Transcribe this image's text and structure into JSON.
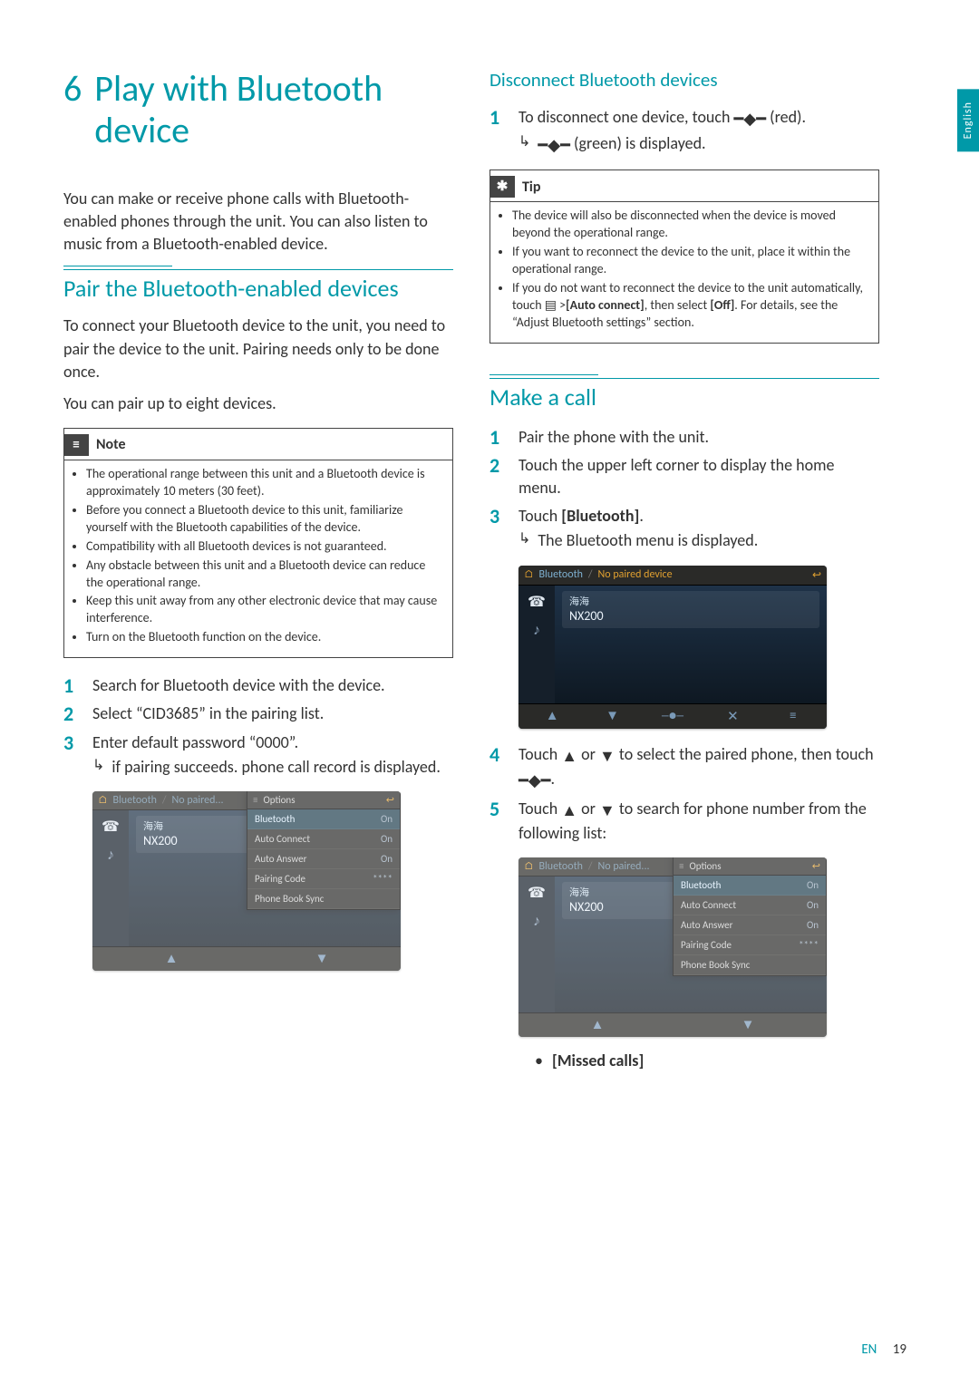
{
  "chapter": {
    "num": "6",
    "title": "Play with Bluetooth device"
  },
  "language_tab": "English",
  "intro": "You can make or receive phone calls with Bluetooth-enabled phones through the unit. You can also listen to music from a Bluetooth-enabled device.",
  "section_pair": {
    "title": "Pair the Bluetooth-enabled devices",
    "p1": "To connect your Bluetooth device to the unit, you need to pair the device to the unit. Pairing needs only to be done once.",
    "p2": "You can pair up to eight devices.",
    "note_label": "Note",
    "notes": [
      "The operational range between this unit and a Bluetooth device is approximately 10 meters (30 feet).",
      "Before you connect a Bluetooth device to this unit, familiarize yourself with the Bluetooth capabilities of the device.",
      "Compatibility with all Bluetooth devices is not guaranteed.",
      "Any obstacle between this unit and a Bluetooth device can reduce the operational range.",
      "Keep this unit away from any other electronic device that may cause interference.",
      "Turn on the Bluetooth function on the device."
    ],
    "steps": {
      "s1": "Search for Bluetooth device with the device.",
      "s2": "Select “CID3685” in the pairing list.",
      "s3": "Enter default password “0000”.",
      "s3_result": "if pairing succeeds. phone call record is displayed."
    }
  },
  "section_disconnect": {
    "title": "Disconnect Bluetooth devices",
    "s1_a": "To disconnect one device, touch ",
    "s1_b": " (red).",
    "s1_result_a": "",
    "s1_result_b": " (green) is displayed.",
    "tip_label": "Tip",
    "tips": [
      "The device will also be disconnected when the device is moved beyond the operational range.",
      "If you want to reconnect the device to the unit, place it within the operational range.",
      "If you do not want to reconnect the device to the unit automatically, touch ≡ >[Auto connect], then select [Off]. For details, see the “Adjust Bluetooth settings” section."
    ],
    "tip3_pre": "If you do not want to reconnect the device to the unit automatically, touch ",
    "tip3_mid": " >",
    "tip3_bold1": "[Auto connect]",
    "tip3_mid2": ", then select ",
    "tip3_bold2": "[Off]",
    "tip3_post": ". For details, see the “Adjust Bluetooth settings” section."
  },
  "section_call": {
    "title": "Make a call",
    "s1": "Pair the phone with the unit.",
    "s2": "Touch the upper left corner to display the home menu.",
    "s3_a": "Touch ",
    "s3_b": "[Bluetooth]",
    "s3_c": ".",
    "s3_result": "The Bluetooth menu is displayed.",
    "s4_a": "Touch ",
    "s4_b": " or ",
    "s4_c": " to select the paired phone, then touch ",
    "s4_d": ".",
    "s5_a": "Touch ",
    "s5_b": " or ",
    "s5_c": " to search for phone number from the following list:",
    "missed": "[Missed calls]"
  },
  "screenshots": {
    "dimmed": true,
    "header_home": "⌂",
    "header_bt": "Bluetooth",
    "header_status": "No paired device",
    "header_return": "↩",
    "device_sub": "海海",
    "device_name": "NX200",
    "side_phone": "☎",
    "side_music": "♪",
    "foot_up": "▲",
    "foot_down": "▼",
    "foot_link": "─●─",
    "foot_x": "✕",
    "foot_menu": "≡",
    "options": {
      "title": "Options",
      "rows": [
        {
          "label": "Bluetooth",
          "val": "On",
          "sel": true
        },
        {
          "label": "Auto Connect",
          "val": "On",
          "sel": false
        },
        {
          "label": "Auto Answer",
          "val": "On",
          "sel": false
        },
        {
          "label": "Pairing Code",
          "val": "****",
          "sel": false
        },
        {
          "label": "Phone Book Sync",
          "val": "",
          "sel": false
        }
      ]
    }
  },
  "footer": {
    "lang": "EN",
    "page": "19"
  }
}
